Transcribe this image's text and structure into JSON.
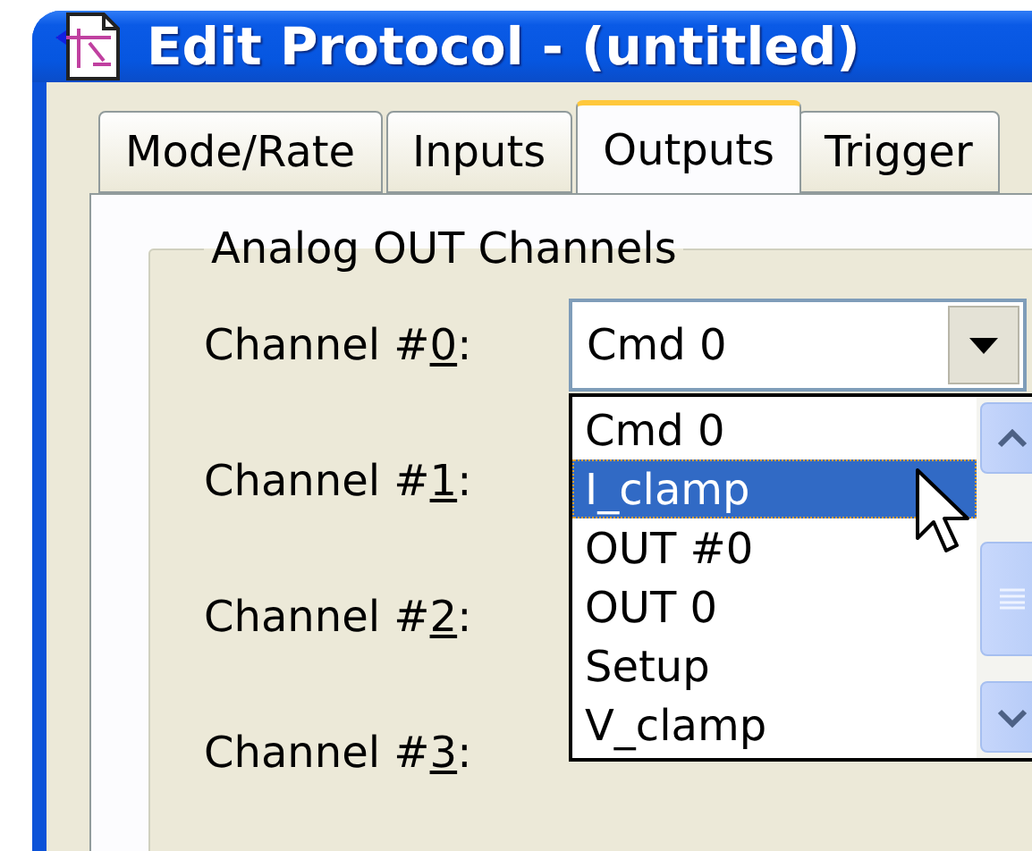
{
  "window": {
    "title": "Edit Protocol - (untitled)"
  },
  "tabs": [
    {
      "label": "Mode/Rate",
      "selected": false
    },
    {
      "label": "Inputs",
      "selected": false
    },
    {
      "label": "Outputs",
      "selected": true
    },
    {
      "label": "Trigger",
      "selected": false
    }
  ],
  "group": {
    "title": "Analog OUT Channels"
  },
  "channels": [
    {
      "label_before": "Channel #",
      "access_key": "0",
      "label_after": ":",
      "value": "Cmd 0"
    },
    {
      "label_before": "Channel #",
      "access_key": "1",
      "label_after": ":"
    },
    {
      "label_before": "Channel #",
      "access_key": "2",
      "label_after": ":"
    },
    {
      "label_before": "Channel #",
      "access_key": "3",
      "label_after": ":"
    }
  ],
  "dropdown": {
    "items": [
      {
        "label": "Cmd 0",
        "selected": false
      },
      {
        "label": "I_clamp",
        "selected": true
      },
      {
        "label": "OUT #0",
        "selected": false
      },
      {
        "label": "OUT 0",
        "selected": false
      },
      {
        "label": "Setup",
        "selected": false
      },
      {
        "label": "V_clamp",
        "selected": false
      }
    ]
  }
}
